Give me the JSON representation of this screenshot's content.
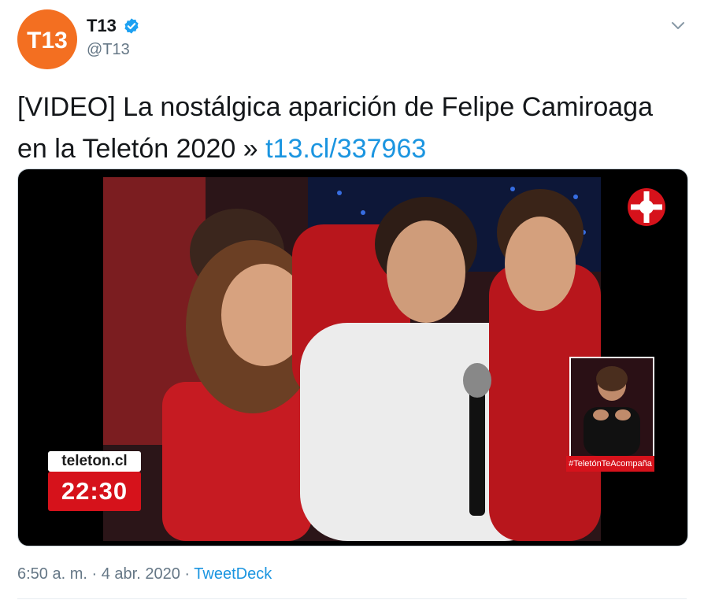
{
  "author": {
    "display_name": "T13",
    "handle": "@T13",
    "avatar_text": "T13"
  },
  "tweet": {
    "text": "[VIDEO] La nostálgica aparición de Felipe Camiroaga en la Teletón 2020 »",
    "link": "t13.cl/337963"
  },
  "video_overlay": {
    "site": "teleton.cl",
    "clock": "22:30",
    "hashtag": "#TeletónTeAcompaña"
  },
  "meta": {
    "time": "6:50 a. m.",
    "separator": "·",
    "date": "4 abr. 2020",
    "source": "TweetDeck"
  },
  "colors": {
    "avatar_bg": "#f36f21",
    "verified": "#1da1f2",
    "link": "#1b95e0",
    "muted": "#657786",
    "tv_red": "#d6121b"
  }
}
